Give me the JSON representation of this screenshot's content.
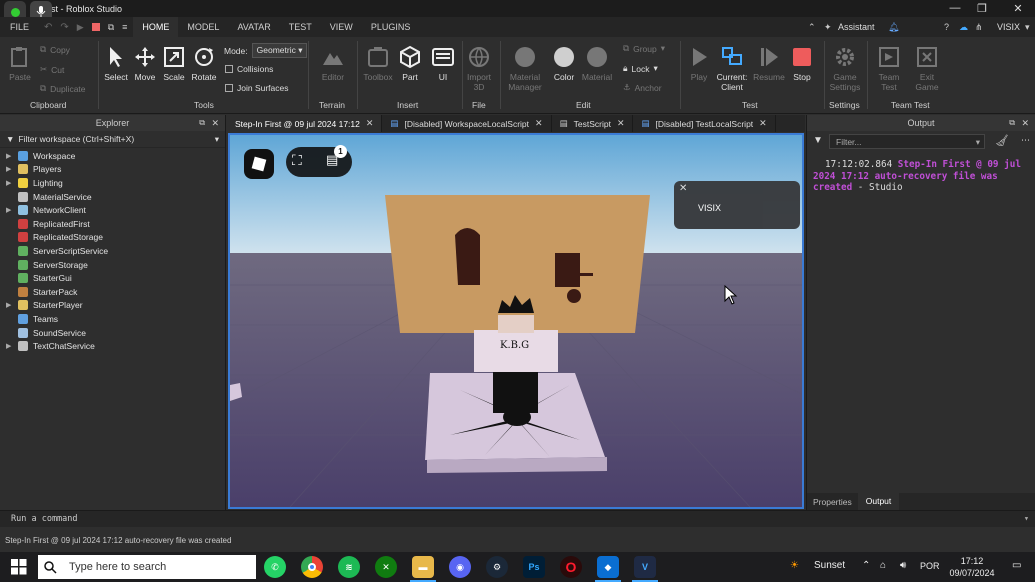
{
  "window": {
    "title": "rst - Roblox Studio",
    "file_label": "FILE"
  },
  "menu": {
    "tabs": [
      "HOME",
      "MODEL",
      "AVATAR",
      "TEST",
      "VIEW",
      "PLUGINS"
    ],
    "assistant": "Assistant",
    "user": "VISIX"
  },
  "ribbon": {
    "clipboard": {
      "paste": "Paste",
      "copy": "Copy",
      "cut": "Cut",
      "duplicate": "Duplicate",
      "group": "Clipboard"
    },
    "tools": {
      "select": "Select",
      "move": "Move",
      "scale": "Scale",
      "rotate": "Rotate",
      "group": "Tools",
      "mode_label": "Mode:",
      "mode_value": "Geometric",
      "collisions": "Collisions",
      "join_surfaces": "Join Surfaces"
    },
    "terrain": {
      "editor": "Editor",
      "group": "Terrain"
    },
    "insert": {
      "toolbox": "Toolbox",
      "part": "Part",
      "ui": "UI",
      "group": "Insert"
    },
    "file": {
      "import": "Import 3D",
      "group": "File"
    },
    "edit": {
      "material_manager": "Material Manager",
      "color": "Color",
      "material": "Material",
      "group_btn": "Group",
      "lock": "Lock",
      "anchor": "Anchor",
      "group": "Edit"
    },
    "test": {
      "play": "Play",
      "current_client": "Current: Client",
      "resume": "Resume",
      "stop": "Stop",
      "group": "Test"
    },
    "settings": {
      "game_settings": "Game Settings",
      "group": "Settings"
    },
    "team_test": {
      "team_test": "Team Test",
      "exit_game": "Exit Game",
      "group": "Team Test"
    }
  },
  "explorer": {
    "title": "Explorer",
    "filter": "Filter workspace (Ctrl+Shift+X)",
    "items": [
      {
        "label": "Workspace",
        "arrow": true,
        "color": "#5aa0e0"
      },
      {
        "label": "Players",
        "arrow": true,
        "color": "#e0c060"
      },
      {
        "label": "Lighting",
        "arrow": true,
        "color": "#f0d040"
      },
      {
        "label": "MaterialService",
        "arrow": false,
        "color": "#c0c0c0"
      },
      {
        "label": "NetworkClient",
        "arrow": true,
        "color": "#8fc0e0"
      },
      {
        "label": "ReplicatedFirst",
        "arrow": false,
        "color": "#d04040"
      },
      {
        "label": "ReplicatedStorage",
        "arrow": false,
        "color": "#d04040"
      },
      {
        "label": "ServerScriptService",
        "arrow": false,
        "color": "#60b060"
      },
      {
        "label": "ServerStorage",
        "arrow": false,
        "color": "#60b060"
      },
      {
        "label": "StarterGui",
        "arrow": false,
        "color": "#60b060"
      },
      {
        "label": "StarterPack",
        "arrow": false,
        "color": "#c08040"
      },
      {
        "label": "StarterPlayer",
        "arrow": true,
        "color": "#e0c060"
      },
      {
        "label": "Teams",
        "arrow": false,
        "color": "#60a0e0"
      },
      {
        "label": "SoundService",
        "arrow": false,
        "color": "#a0c0e0"
      },
      {
        "label": "TextChatService",
        "arrow": true,
        "color": "#c0c0c0"
      }
    ]
  },
  "tabs": [
    {
      "label": "Step-In First @ 09 jul 2024 17:12",
      "active": true
    },
    {
      "label": "[Disabled] WorkspaceLocalScript",
      "active": false
    },
    {
      "label": "TestScript",
      "active": false
    },
    {
      "label": "[Disabled] TestLocalScript",
      "active": false
    }
  ],
  "viewport": {
    "notification_badge": "1",
    "popup_name": "VISIX",
    "shirt_text": "K.B.G"
  },
  "output": {
    "title": "Output",
    "filter_placeholder": "Filter...",
    "time": "17:12:02.864",
    "message": "Step-In First @ 09 jul 2024 17:12 auto-recovery file was created",
    "source": "Studio",
    "bottom_tabs": [
      "Properties",
      "Output"
    ]
  },
  "command": {
    "placeholder": "Run a command"
  },
  "status": {
    "text": "Step-In First @ 09 jul 2024 17:12 auto-recovery file was created"
  },
  "taskbar": {
    "search": "Type here to search",
    "weather": "Sunset",
    "lang": "POR",
    "time": "17:12",
    "date": "09/07/2024"
  }
}
